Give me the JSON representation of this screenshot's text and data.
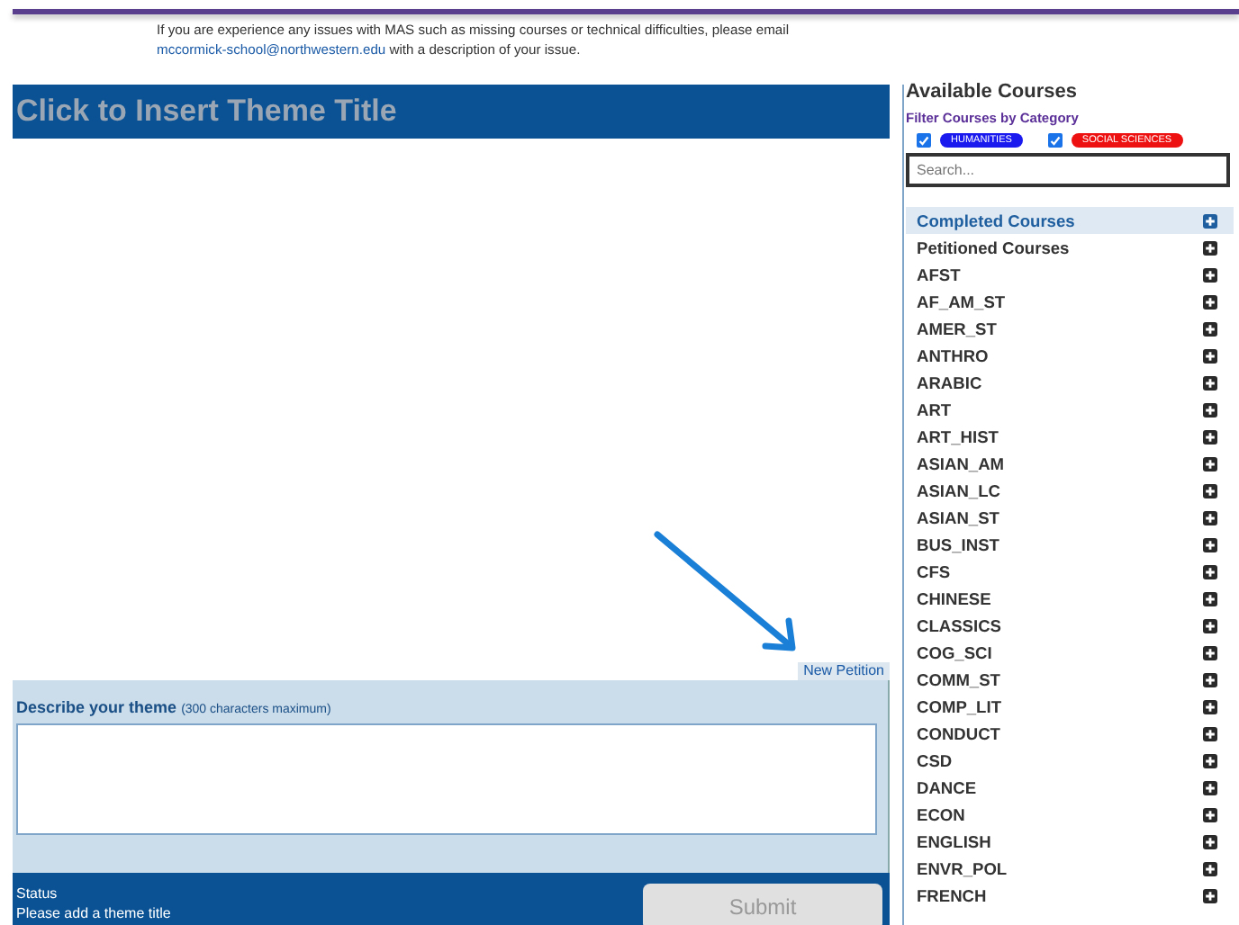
{
  "notice": {
    "text": "If you are experience any issues with MAS such as missing courses or technical difficulties, please email",
    "link": "mccormick-school@northwestern.edu",
    "after": "with a description of your issue."
  },
  "theme": {
    "title": "Click to Insert Theme Title",
    "new_petition": "New Petition",
    "describe_label": "Describe your theme",
    "describe_hint": "(300 characters maximum)"
  },
  "status": {
    "label": "Status",
    "message": "Please add a theme title",
    "submit": "Submit",
    "submit_disabled": true
  },
  "sidebar": {
    "title": "Available Courses",
    "filter_label": "Filter Courses by Category",
    "filters": [
      {
        "label": "HUMANITIES",
        "checked": true,
        "color": "#1a1aef"
      },
      {
        "label": "SOCIAL SCIENCES",
        "checked": true,
        "color": "#ee1111"
      }
    ],
    "search": {
      "placeholder": "Search..."
    },
    "items": [
      {
        "label": "Completed Courses",
        "selected": true
      },
      {
        "label": "Petitioned Courses",
        "selected": false
      },
      {
        "label": "AFST",
        "selected": false
      },
      {
        "label": "AF_AM_ST",
        "selected": false
      },
      {
        "label": "AMER_ST",
        "selected": false
      },
      {
        "label": "ANTHRO",
        "selected": false
      },
      {
        "label": "ARABIC",
        "selected": false
      },
      {
        "label": "ART",
        "selected": false
      },
      {
        "label": "ART_HIST",
        "selected": false
      },
      {
        "label": "ASIAN_AM",
        "selected": false
      },
      {
        "label": "ASIAN_LC",
        "selected": false
      },
      {
        "label": "ASIAN_ST",
        "selected": false
      },
      {
        "label": "BUS_INST",
        "selected": false
      },
      {
        "label": "CFS",
        "selected": false
      },
      {
        "label": "CHINESE",
        "selected": false
      },
      {
        "label": "CLASSICS",
        "selected": false
      },
      {
        "label": "COG_SCI",
        "selected": false
      },
      {
        "label": "COMM_ST",
        "selected": false
      },
      {
        "label": "COMP_LIT",
        "selected": false
      },
      {
        "label": "CONDUCT",
        "selected": false
      },
      {
        "label": "CSD",
        "selected": false
      },
      {
        "label": "DANCE",
        "selected": false
      },
      {
        "label": "ECON",
        "selected": false
      },
      {
        "label": "ENGLISH",
        "selected": false
      },
      {
        "label": "ENVR_POL",
        "selected": false
      },
      {
        "label": "FRENCH",
        "selected": false
      }
    ]
  }
}
